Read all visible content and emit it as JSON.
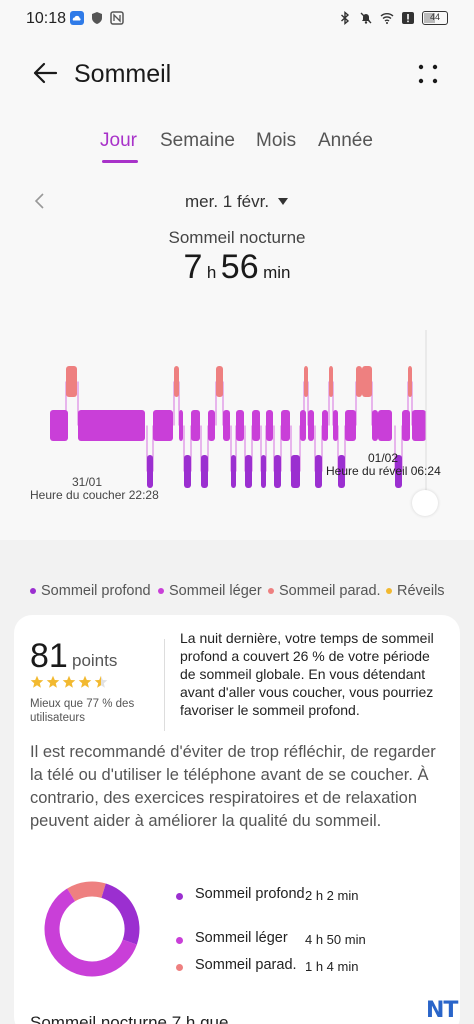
{
  "status_bar": {
    "time": "10:18",
    "battery": "44",
    "left_icons": [
      "cloud-app-icon",
      "shield-icon",
      "nfc-icon"
    ],
    "right_icons": [
      "bluetooth-icon",
      "muted-bell-icon",
      "wifi-icon",
      "alert-icon",
      "battery-icon"
    ]
  },
  "header": {
    "title": "Sommeil",
    "back_icon": "back-arrow-icon",
    "more_icon": "more-dots-icon"
  },
  "tabs": [
    {
      "label": "Jour",
      "active": true
    },
    {
      "label": "Semaine",
      "active": false
    },
    {
      "label": "Mois",
      "active": false
    },
    {
      "label": "Année",
      "active": false
    }
  ],
  "date_nav": {
    "label": "mer. 1 févr."
  },
  "summary": {
    "title": "Sommeil nocturne",
    "hours": "7",
    "hours_unit": "h",
    "minutes": "56",
    "minutes_unit": "min"
  },
  "chart_data": {
    "type": "timeline",
    "start_date": "31/01",
    "start_label": "Heure du coucher 22:28",
    "end_date": "01/02",
    "end_label": "Heure du réveil 06:24",
    "stages": [
      "Sommeil profond",
      "Sommeil léger",
      "Sommeil parad.",
      "Réveils"
    ],
    "colors": {
      "Sommeil profond": "#9b2fd0",
      "Sommeil léger": "#c93fd8",
      "Sommeil parad.": "#ee8080",
      "Réveils": "#f2b930"
    }
  },
  "legend": [
    {
      "label": "Sommeil profond",
      "color": "#9b2fd0"
    },
    {
      "label": "Sommeil léger",
      "color": "#c93fd8"
    },
    {
      "label": "Sommeil parad.",
      "color": "#ee8080"
    },
    {
      "label": "Réveils",
      "color": "#f2b930"
    }
  ],
  "score": {
    "value": "81",
    "unit": "points",
    "stars": 4.5,
    "compare": "Mieux que 77 % des utilisateurs",
    "message": "La nuit dernière, votre temps de sommeil profond a couvert 26 % de votre période de sommeil globale. En vous détendant avant d'aller vous coucher, vous pourriez favoriser le sommeil profond."
  },
  "advice": "Il est recommandé d'éviter de trop réfléchir, de regarder la télé ou d'utiliser le téléphone avant de se coucher. À contrario, des exercices respiratoires et de relaxation peuvent aider à améliorer la qualité du sommeil.",
  "stages": [
    {
      "name": "Sommeil profond",
      "value": "2 h 2 min",
      "minutes": 122,
      "color": "#9b2fd0"
    },
    {
      "name": "Sommeil léger",
      "value": "4 h 50 min",
      "minutes": 290,
      "color": "#c93fd8"
    },
    {
      "name": "Sommeil parad.",
      "value": "1 h 4 min",
      "minutes": 64,
      "color": "#ee8080"
    }
  ],
  "bottom_text": "Sommeil nocturne 7 h que",
  "watermark": "NT"
}
